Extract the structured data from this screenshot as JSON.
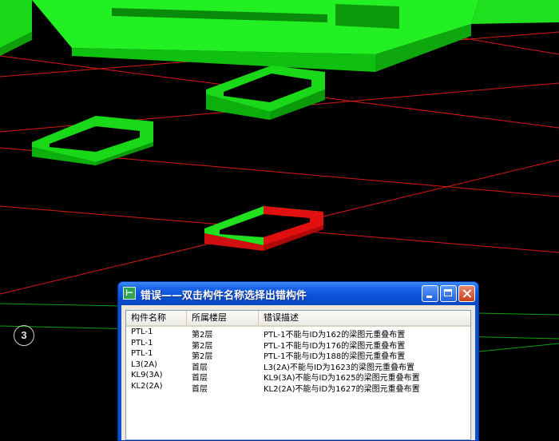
{
  "viewport": {
    "axis_label": "3",
    "colors": {
      "background": "#000000",
      "component": "#12e012",
      "error_component": "#e01010",
      "grid_red": "#d81818",
      "grid_green": "#10a010"
    }
  },
  "error_window": {
    "title": "错误——双击构件名称选择出错构件",
    "icon_glyph": "⊢",
    "columns": [
      "构件名称",
      "所属楼层",
      "错误描述"
    ],
    "rows": [
      {
        "name": "PTL-1",
        "floor": "第2层",
        "desc": "PTL-1不能与ID为162的梁图元重叠布置"
      },
      {
        "name": "PTL-1",
        "floor": "第2层",
        "desc": "PTL-1不能与ID为176的梁图元重叠布置"
      },
      {
        "name": "PTL-1",
        "floor": "第2层",
        "desc": "PTL-1不能与ID为188的梁图元重叠布置"
      },
      {
        "name": "L3(2A)",
        "floor": "首层",
        "desc": "L3(2A)不能与ID为1623的梁图元重叠布置"
      },
      {
        "name": "KL9(3A)",
        "floor": "首层",
        "desc": "KL9(3A)不能与ID为1625的梁图元重叠布置"
      },
      {
        "name": "KL2(2A)",
        "floor": "首层",
        "desc": "KL2(2A)不能与ID为1627的梁图元重叠布置"
      }
    ]
  }
}
